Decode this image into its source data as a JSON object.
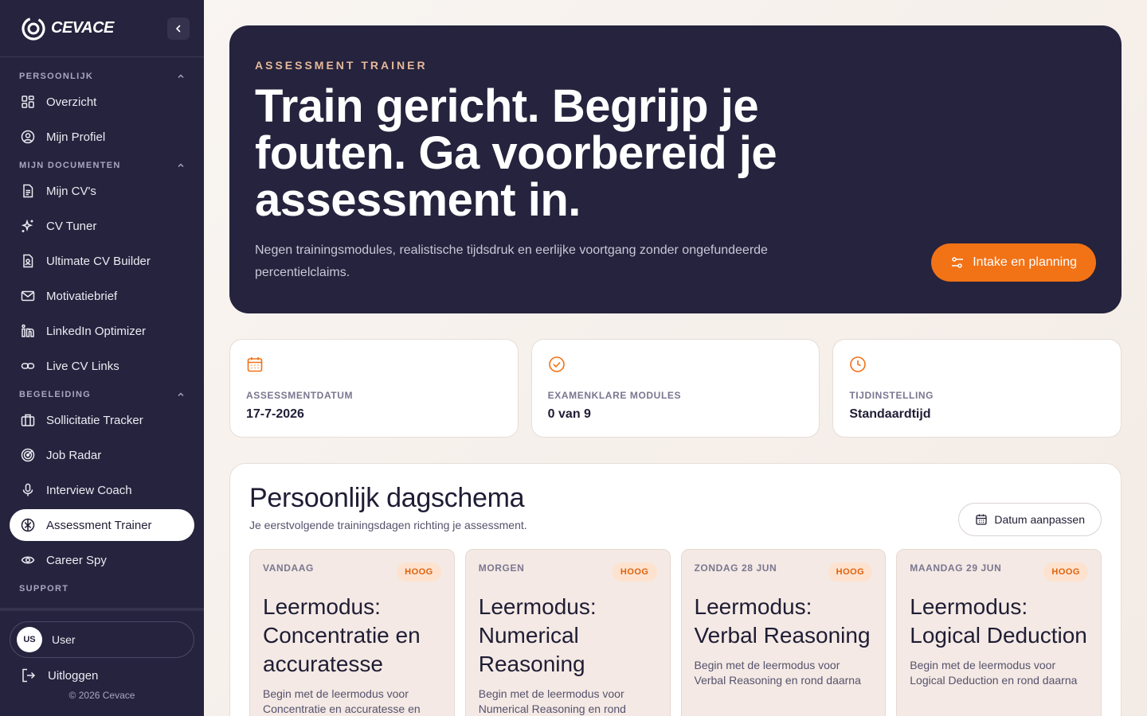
{
  "brand": {
    "name": "CEVACE"
  },
  "sidebar": {
    "sections": [
      {
        "title": "PERSOONLIJK",
        "items": [
          {
            "label": "Overzicht",
            "icon": "dashboard-icon"
          },
          {
            "label": "Mijn Profiel",
            "icon": "user-circle-icon"
          }
        ]
      },
      {
        "title": "MIJN DOCUMENTEN",
        "items": [
          {
            "label": "Mijn CV's",
            "icon": "file-text-icon"
          },
          {
            "label": "CV Tuner",
            "icon": "sparkles-icon"
          },
          {
            "label": "Ultimate CV Builder",
            "icon": "file-user-icon"
          },
          {
            "label": "Motivatiebrief",
            "icon": "mail-icon"
          },
          {
            "label": "LinkedIn Optimizer",
            "icon": "linkedin-icon"
          },
          {
            "label": "Live CV Links",
            "icon": "link-icon"
          }
        ]
      },
      {
        "title": "BEGELEIDING",
        "items": [
          {
            "label": "Sollicitatie Tracker",
            "icon": "briefcase-icon"
          },
          {
            "label": "Job Radar",
            "icon": "radar-icon"
          },
          {
            "label": "Interview Coach",
            "icon": "microphone-icon"
          },
          {
            "label": "Assessment Trainer",
            "icon": "brain-icon",
            "active": true
          },
          {
            "label": "Career Spy",
            "icon": "eye-icon"
          }
        ]
      },
      {
        "title": "SUPPORT",
        "items": []
      }
    ],
    "user": {
      "initials": "US",
      "name": "User"
    },
    "logout_label": "Uitloggen",
    "copyright": "© 2026 Cevace"
  },
  "hero": {
    "kicker": "ASSESSMENT TRAINER",
    "title": "Train gericht. Begrijp je fouten. Ga voorbereid je assessment in.",
    "subtitle": "Negen trainingsmodules, realistische tijdsdruk en eerlijke voortgang zonder ongefundeerde percentielclaims.",
    "cta_label": "Intake en planning"
  },
  "stats": [
    {
      "label": "ASSESSMENTDATUM",
      "value": "17-7-2026",
      "icon": "calendar-icon"
    },
    {
      "label": "EXAMENKLARE MODULES",
      "value": "0 van 9",
      "icon": "check-circle-icon"
    },
    {
      "label": "TIJDINSTELLING",
      "value": "Standaardtijd",
      "icon": "clock-icon"
    }
  ],
  "schedule": {
    "title": "Persoonlijk dagschema",
    "subtitle": "Je eerstvolgende trainingsdagen richting je assessment.",
    "date_button": "Datum aanpassen",
    "days": [
      {
        "label": "VANDAAG",
        "badge": "HOOG",
        "title": "Leermodus: Concentratie en accuratesse",
        "desc": "Begin met de leermodus voor Concentratie en accuratesse en"
      },
      {
        "label": "MORGEN",
        "badge": "HOOG",
        "title": "Leermodus: Numerical Reasoning",
        "desc": "Begin met de leermodus voor Numerical Reasoning en rond"
      },
      {
        "label": "ZONDAG 28 JUN",
        "badge": "HOOG",
        "title": "Leermodus: Verbal Reasoning",
        "desc": "Begin met de leermodus voor Verbal Reasoning en rond daarna"
      },
      {
        "label": "MAANDAG 29 JUN",
        "badge": "HOOG",
        "title": "Leermodus: Logical Deduction",
        "desc": "Begin met de leermodus voor Logical Deduction en rond daarna"
      }
    ]
  },
  "colors": {
    "accent": "#f27216",
    "sidebar": "#25233d"
  }
}
